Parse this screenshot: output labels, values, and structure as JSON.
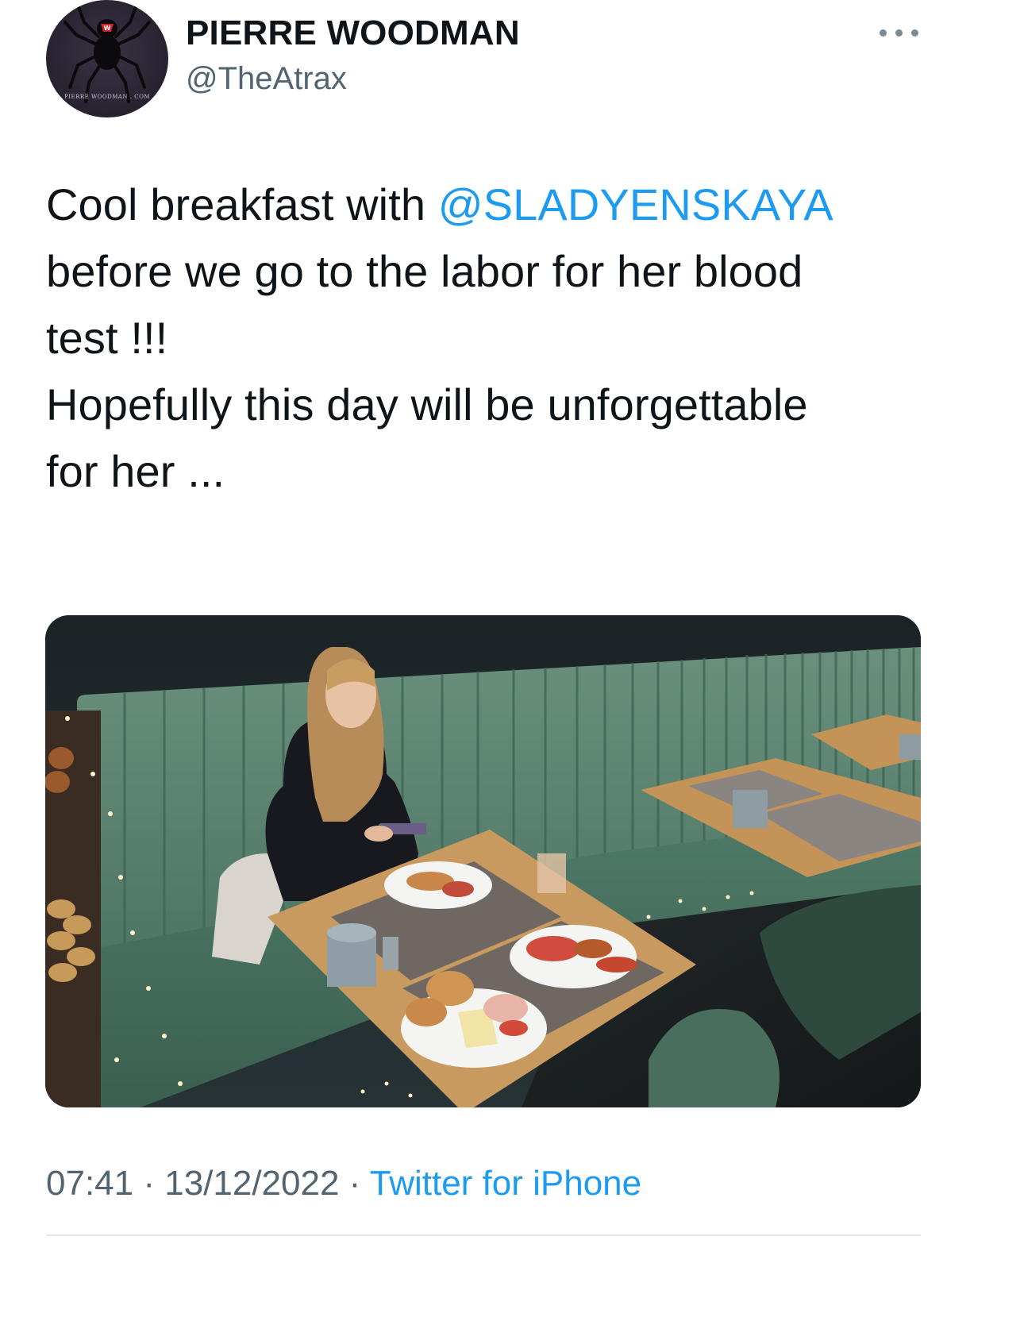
{
  "tweet": {
    "author": {
      "display_name": "PIERRE WOODMAN",
      "handle": "@TheAtrax",
      "avatar_icon": "spider-logo-icon",
      "avatar_logo_text": "PIERRE WOODMAN . COM"
    },
    "more_icon": "more-horizontal-icon",
    "text": {
      "line1_prefix": "Cool breakfast with ",
      "mention": "@SLADYENSKAYA",
      "line2": "before we go to the labor for her blood",
      "line3": "test !!!",
      "line4": "Hopefully this day will be unforgettable",
      "line5": "for her ..."
    },
    "media": {
      "type": "photo"
    },
    "meta": {
      "time": "07:41",
      "separator1": " · ",
      "date": "13/12/2022",
      "separator2": " · ",
      "source": "Twitter for iPhone"
    },
    "colors": {
      "link": "#1d9bf0",
      "text": "#0f1419",
      "secondary": "#536471"
    }
  }
}
